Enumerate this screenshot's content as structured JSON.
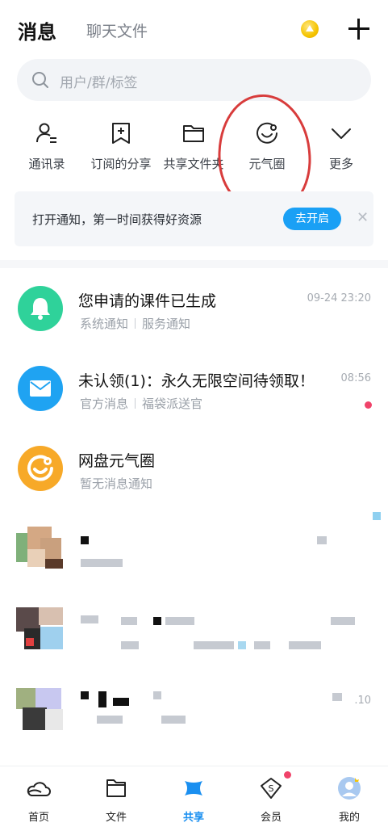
{
  "header": {
    "tabs": [
      {
        "label": "消息",
        "active": true
      },
      {
        "label": "聊天文件",
        "active": false
      }
    ],
    "coin_icon": "gold-coin-icon",
    "add_icon": "plus-icon"
  },
  "search": {
    "placeholder": "用户/群/标签",
    "icon": "search-icon"
  },
  "quick_actions": [
    {
      "label": "通讯录",
      "icon": "contacts-icon"
    },
    {
      "label": "订阅的分享",
      "icon": "bookmark-plus-icon"
    },
    {
      "label": "共享文件夹",
      "icon": "folder-icon"
    },
    {
      "label": "元气圈",
      "icon": "smile-circle-icon"
    },
    {
      "label": "更多",
      "icon": "chevron-down-icon"
    }
  ],
  "notice": {
    "text": "打开通知，第一时间获得好资源",
    "button": "去开启",
    "close_icon": "close-icon"
  },
  "messages": [
    {
      "title": "您申请的课件已生成",
      "sub": [
        "系统通知",
        "服务通知"
      ],
      "time": "09-24 23:20",
      "avatar_color": "#2fd29a",
      "icon": "bell-icon",
      "unread": false
    },
    {
      "title": "未认领(1)：永久无限空间待领取！",
      "sub": [
        "官方消息",
        "福袋派送官"
      ],
      "time": "08:56",
      "avatar_color": "#1fa3f2",
      "icon": "envelope-icon",
      "unread": true
    },
    {
      "title": "网盘元气圈",
      "sub": [
        "暂无消息通知"
      ],
      "time": "",
      "avatar_color": "#f7a928",
      "icon": "smile-circle-icon",
      "unread": false
    }
  ],
  "blurred_rows": [
    {
      "time": ""
    },
    {
      "time": ""
    },
    {
      "time": ".10"
    }
  ],
  "tabbar": [
    {
      "label": "首页",
      "icon": "cloud-home-icon",
      "active": false
    },
    {
      "label": "文件",
      "icon": "folder-icon",
      "active": false
    },
    {
      "label": "共享",
      "icon": "share-x-icon",
      "active": true
    },
    {
      "label": "会员",
      "icon": "vip-diamond-icon",
      "active": false
    },
    {
      "label": "我的",
      "icon": "profile-avatar-icon",
      "active": false
    }
  ],
  "colors": {
    "accent": "#1a8ff0",
    "notice_button": "#1aa0f5",
    "unread_dot": "#f0436a",
    "annotation_circle": "#d83c3c"
  }
}
